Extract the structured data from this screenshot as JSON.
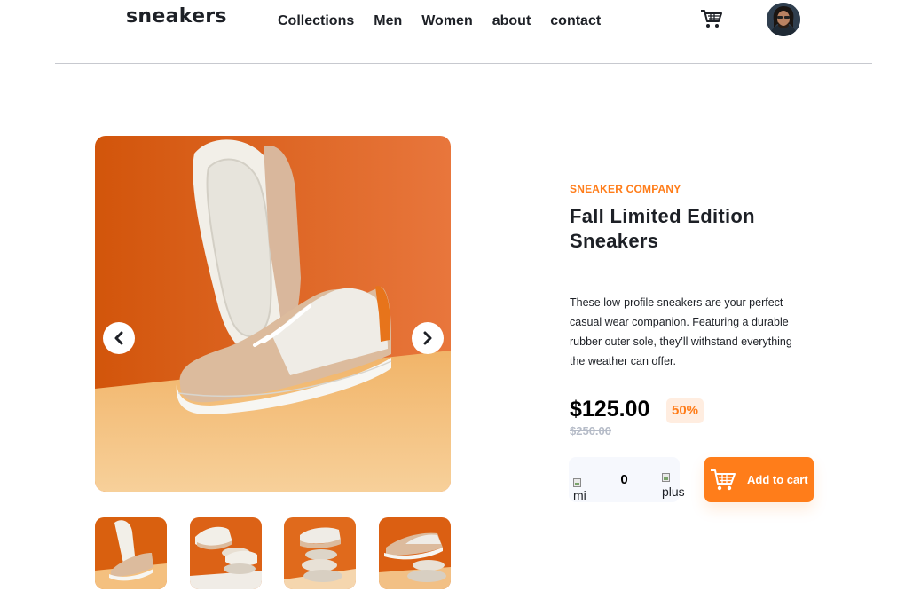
{
  "header": {
    "logo": "sneakers",
    "nav": [
      "Collections",
      "Men",
      "Women",
      "about",
      "contact"
    ],
    "cart_icon": "cart-icon",
    "avatar_icon": "avatar"
  },
  "gallery": {
    "prev_icon": "chevron-left-icon",
    "next_icon": "chevron-right-icon",
    "thumbnail_count": 4
  },
  "product": {
    "company": "SNEAKER COMPANY",
    "title": "Fall Limited Edition Sneakers",
    "description": "These low-profile sneakers are your perfect casual wear companion. Featuring a durable rubber outer sole, they’ll withstand everything the weather can offer.",
    "price": "$125.00",
    "discount": "50%",
    "old_price": "$250.00"
  },
  "cart_controls": {
    "minus_alt": "minus",
    "minus_visible": "mi",
    "quantity": "0",
    "plus_alt": "plus",
    "add_label": "Add to cart"
  },
  "colors": {
    "accent": "#ff7d1a",
    "accent_pale": "#ffede0",
    "text_dark": "#1d2026",
    "muted": "#b6bcc8",
    "qty_bg": "#f6f8fd"
  }
}
